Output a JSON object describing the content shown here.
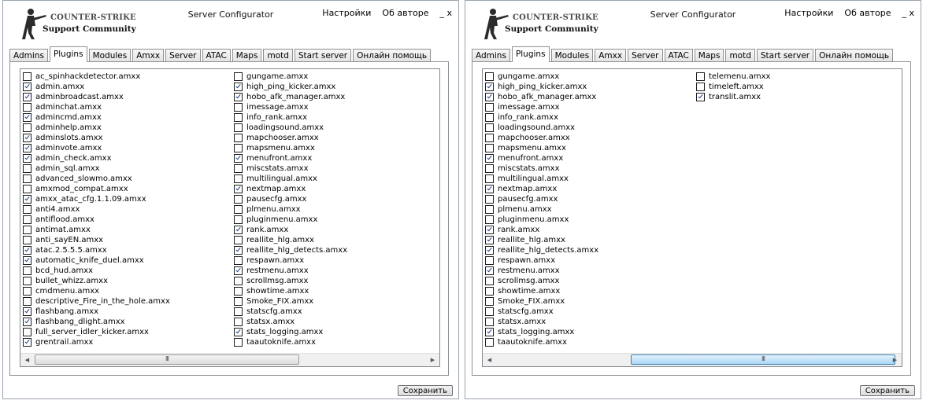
{
  "windows": [
    {
      "logo": {
        "line1": "COUNTER-STRIKE",
        "line2": "Support Community"
      },
      "title": "Server Configurator",
      "menu": {
        "settings": "Настройки",
        "about": "Об авторе",
        "window_controls": "_ x"
      },
      "tabs": [
        "Admins",
        "Plugins",
        "Modules",
        "Amxx",
        "Server",
        "ATAC",
        "Maps",
        "motd",
        "Start server",
        "Онлайн помощь"
      ],
      "active_tab": "Plugins",
      "columns": [
        [
          {
            "name": "ac_spinhackdetector.amxx",
            "checked": false
          },
          {
            "name": "admin.amxx",
            "checked": true
          },
          {
            "name": "adminbroadcast.amxx",
            "checked": true
          },
          {
            "name": "adminchat.amxx",
            "checked": false
          },
          {
            "name": "admincmd.amxx",
            "checked": true
          },
          {
            "name": "adminhelp.amxx",
            "checked": false
          },
          {
            "name": "adminslots.amxx",
            "checked": true
          },
          {
            "name": "adminvote.amxx",
            "checked": true
          },
          {
            "name": "admin_check.amxx",
            "checked": true
          },
          {
            "name": "admin_sql.amxx",
            "checked": false
          },
          {
            "name": "advanced_slowmo.amxx",
            "checked": false
          },
          {
            "name": "amxmod_compat.amxx",
            "checked": false
          },
          {
            "name": "amxx_atac_cfg.1.1.09.amxx",
            "checked": true
          },
          {
            "name": "anti4.amxx",
            "checked": false
          },
          {
            "name": "antiflood.amxx",
            "checked": false
          },
          {
            "name": "antimat.amxx",
            "checked": false
          },
          {
            "name": "anti_sayEN.amxx",
            "checked": false
          },
          {
            "name": "atac.2.5.5.5.amxx",
            "checked": true
          },
          {
            "name": "automatic_knife_duel.amxx",
            "checked": true
          },
          {
            "name": "bcd_hud.amxx",
            "checked": false
          },
          {
            "name": "bullet_whizz.amxx",
            "checked": false
          },
          {
            "name": "cmdmenu.amxx",
            "checked": false
          },
          {
            "name": "descriptive_Fire_in_the_hole.amxx",
            "checked": false
          },
          {
            "name": "flashbang.amxx",
            "checked": true
          },
          {
            "name": "flashbang_dlight.amxx",
            "checked": true
          },
          {
            "name": "full_server_idler_kicker.amxx",
            "checked": false
          },
          {
            "name": "grentrail.amxx",
            "checked": true
          }
        ],
        [
          {
            "name": "gungame.amxx",
            "checked": false
          },
          {
            "name": "high_ping_kicker.amxx",
            "checked": true
          },
          {
            "name": "hobo_afk_manager.amxx",
            "checked": true
          },
          {
            "name": "imessage.amxx",
            "checked": false
          },
          {
            "name": "info_rank.amxx",
            "checked": false
          },
          {
            "name": "loadingsound.amxx",
            "checked": false
          },
          {
            "name": "mapchooser.amxx",
            "checked": false
          },
          {
            "name": "mapsmenu.amxx",
            "checked": false
          },
          {
            "name": "menufront.amxx",
            "checked": true
          },
          {
            "name": "miscstats.amxx",
            "checked": false
          },
          {
            "name": "multilingual.amxx",
            "checked": false
          },
          {
            "name": "nextmap.amxx",
            "checked": true
          },
          {
            "name": "pausecfg.amxx",
            "checked": false
          },
          {
            "name": "plmenu.amxx",
            "checked": false
          },
          {
            "name": "pluginmenu.amxx",
            "checked": false
          },
          {
            "name": "rank.amxx",
            "checked": true
          },
          {
            "name": "reallite_hlg.amxx",
            "checked": false
          },
          {
            "name": "reallite_hlg_detects.amxx",
            "checked": true
          },
          {
            "name": "respawn.amxx",
            "checked": false
          },
          {
            "name": "restmenu.amxx",
            "checked": true
          },
          {
            "name": "scrollmsg.amxx",
            "checked": false
          },
          {
            "name": "showtime.amxx",
            "checked": false
          },
          {
            "name": "Smoke_FIX.amxx",
            "checked": false
          },
          {
            "name": "statscfg.amxx",
            "checked": false
          },
          {
            "name": "statsx.amxx",
            "checked": false
          },
          {
            "name": "stats_logging.amxx",
            "checked": true
          },
          {
            "name": "taautoknife.amxx",
            "checked": false
          }
        ]
      ],
      "scroll": {
        "grip": "III"
      },
      "save_label": "Сохранить"
    },
    {
      "logo": {
        "line1": "COUNTER-STRIKE",
        "line2": "Support Community"
      },
      "title": "Server Configurator",
      "menu": {
        "settings": "Настройки",
        "about": "Об авторе",
        "window_controls": "_ x"
      },
      "tabs": [
        "Admins",
        "Plugins",
        "Modules",
        "Amxx",
        "Server",
        "ATAC",
        "Maps",
        "motd",
        "Start server",
        "Онлайн помощь"
      ],
      "active_tab": "Plugins",
      "columns": [
        [
          {
            "name": "gungame.amxx",
            "checked": false
          },
          {
            "name": "high_ping_kicker.amxx",
            "checked": true
          },
          {
            "name": "hobo_afk_manager.amxx",
            "checked": true
          },
          {
            "name": "imessage.amxx",
            "checked": false
          },
          {
            "name": "info_rank.amxx",
            "checked": false
          },
          {
            "name": "loadingsound.amxx",
            "checked": false
          },
          {
            "name": "mapchooser.amxx",
            "checked": false
          },
          {
            "name": "mapsmenu.amxx",
            "checked": false
          },
          {
            "name": "menufront.amxx",
            "checked": true
          },
          {
            "name": "miscstats.amxx",
            "checked": false
          },
          {
            "name": "multilingual.amxx",
            "checked": false
          },
          {
            "name": "nextmap.amxx",
            "checked": true
          },
          {
            "name": "pausecfg.amxx",
            "checked": false
          },
          {
            "name": "plmenu.amxx",
            "checked": false
          },
          {
            "name": "pluginmenu.amxx",
            "checked": false
          },
          {
            "name": "rank.amxx",
            "checked": true
          },
          {
            "name": "reallite_hlg.amxx",
            "checked": true
          },
          {
            "name": "reallite_hlg_detects.amxx",
            "checked": true
          },
          {
            "name": "respawn.amxx",
            "checked": false
          },
          {
            "name": "restmenu.amxx",
            "checked": true
          },
          {
            "name": "scrollmsg.amxx",
            "checked": false
          },
          {
            "name": "showtime.amxx",
            "checked": false
          },
          {
            "name": "Smoke_FIX.amxx",
            "checked": false
          },
          {
            "name": "statscfg.amxx",
            "checked": false
          },
          {
            "name": "statsx.amxx",
            "checked": false
          },
          {
            "name": "stats_logging.amxx",
            "checked": true
          },
          {
            "name": "taautoknife.amxx",
            "checked": false
          }
        ],
        [
          {
            "name": "telemenu.amxx",
            "checked": false
          },
          {
            "name": "timeleft.amxx",
            "checked": false
          },
          {
            "name": "translit.amxx",
            "checked": true
          }
        ]
      ],
      "scroll": {
        "grip": "III"
      },
      "save_label": "Сохранить"
    }
  ]
}
